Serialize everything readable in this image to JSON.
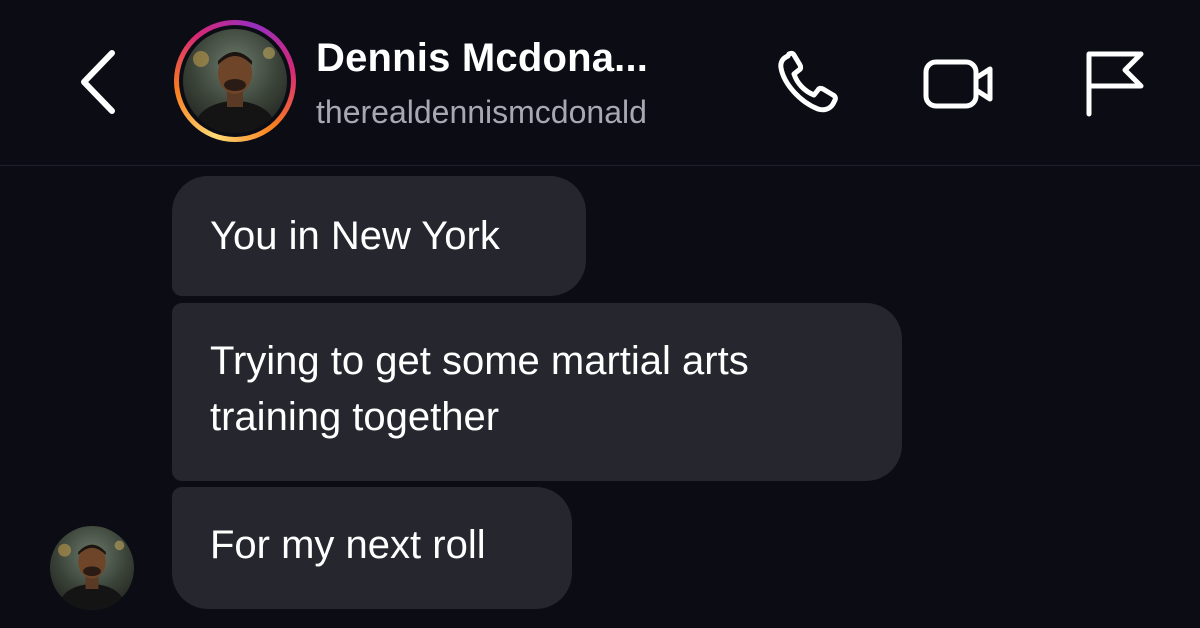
{
  "header": {
    "back_icon": "chevron-left-icon",
    "display_name": "Dennis Mcdona...",
    "username": "therealdennismcdonald",
    "avatar_icon": "profile-photo",
    "actions": [
      {
        "icon": "phone-icon"
      },
      {
        "icon": "video-camera-icon"
      },
      {
        "icon": "flag-icon"
      }
    ]
  },
  "messages": [
    {
      "text": "You in New York"
    },
    {
      "line1": "Trying to get some martial arts",
      "line2": "training together"
    },
    {
      "text": "For my next roll"
    }
  ],
  "colors": {
    "background": "#0c0d14",
    "bubble": "#26272e",
    "username": "#a8a8b3",
    "story_ring": [
      "#feda75",
      "#fa7e1e",
      "#d62976",
      "#962fbf"
    ]
  }
}
